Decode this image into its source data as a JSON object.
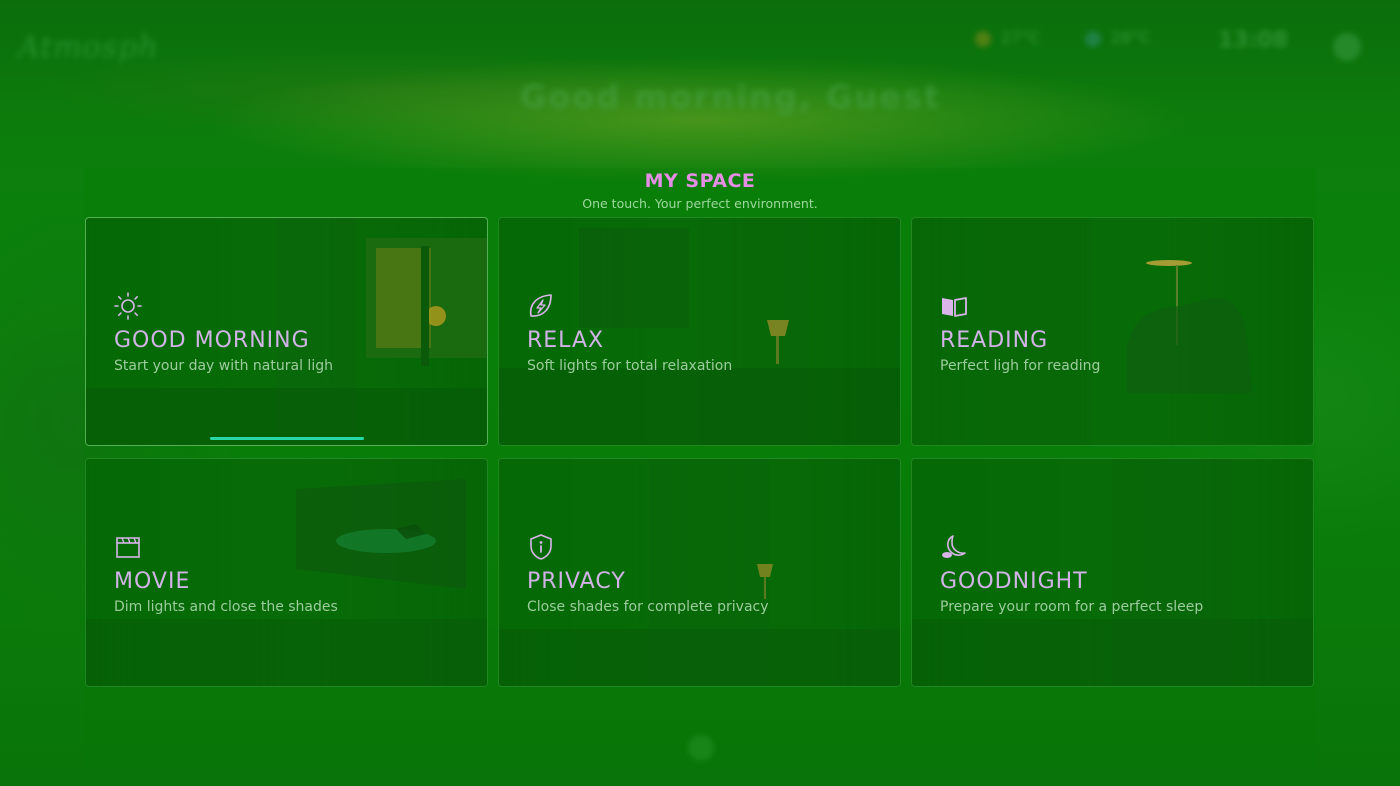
{
  "background": {
    "brand": "Atmosph",
    "greeting": "Good morning, Guest",
    "weather": [
      {
        "temp": "27°C",
        "icon": "sun-icon"
      },
      {
        "temp": "28°C",
        "icon": "humidity-icon"
      }
    ],
    "clock": "13:08"
  },
  "header": {
    "title": "MY SPACE",
    "subtitle": "One touch. Your perfect environment."
  },
  "scenes": [
    {
      "name": "GOOD MORNING",
      "description": "Start your day with natural ligh",
      "icon": "sun-icon",
      "active": true,
      "progress": 0.38
    },
    {
      "name": "RELAX",
      "description": "Soft lights for total relaxation",
      "icon": "leaf-bolt-icon",
      "active": false
    },
    {
      "name": "READING",
      "description": "Perfect ligh for reading",
      "icon": "book-icon",
      "active": false
    },
    {
      "name": "MOVIE",
      "description": "Dim lights and close the shades",
      "icon": "clapperboard-icon",
      "active": false
    },
    {
      "name": "PRIVACY",
      "description": "Close shades for complete privacy",
      "icon": "shield-icon",
      "active": false
    },
    {
      "name": "GOODNIGHT",
      "description": "Prepare your room for a perfect sleep",
      "icon": "moon-icon",
      "active": false
    }
  ],
  "colors": {
    "accent": "#e58ee6",
    "progress": "#27d9a8",
    "card_title": "#d2b3e7",
    "card_desc": "#9dcc9f"
  }
}
